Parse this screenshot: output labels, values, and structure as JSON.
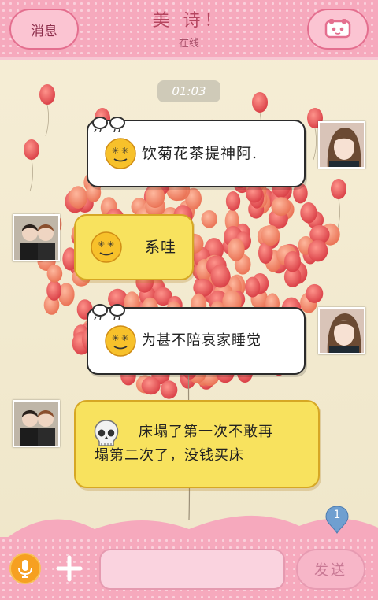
{
  "header": {
    "back_label": "消息",
    "contact_name": "美 诗！",
    "status": "在线",
    "profile_icon": "profile-card-icon"
  },
  "time_divider": "01:03",
  "messages": [
    {
      "direction": "sent",
      "emoji": "dizzy-smiley",
      "text": "饮菊花茶提神阿."
    },
    {
      "direction": "received",
      "emoji": "dizzy-smiley",
      "text": "系哇"
    },
    {
      "direction": "sent",
      "emoji": "dizzy-smiley",
      "text": "为甚不陪哀家睡觉"
    },
    {
      "direction": "received",
      "emoji": "skull",
      "text_line1": "床塌了第一次不敢再",
      "text_line2": "塌第二次了，没钱买床"
    }
  ],
  "unread_count": "1",
  "input_bar": {
    "placeholder": "",
    "send_label": "发送",
    "mic_icon": "microphone-icon",
    "plus_icon": "plus-icon"
  },
  "colors": {
    "header_pink": "#f6a9bd",
    "sent_bubble": "#ffffff",
    "received_bubble": "#f8e25e",
    "mic_orange": "#f6a021"
  }
}
